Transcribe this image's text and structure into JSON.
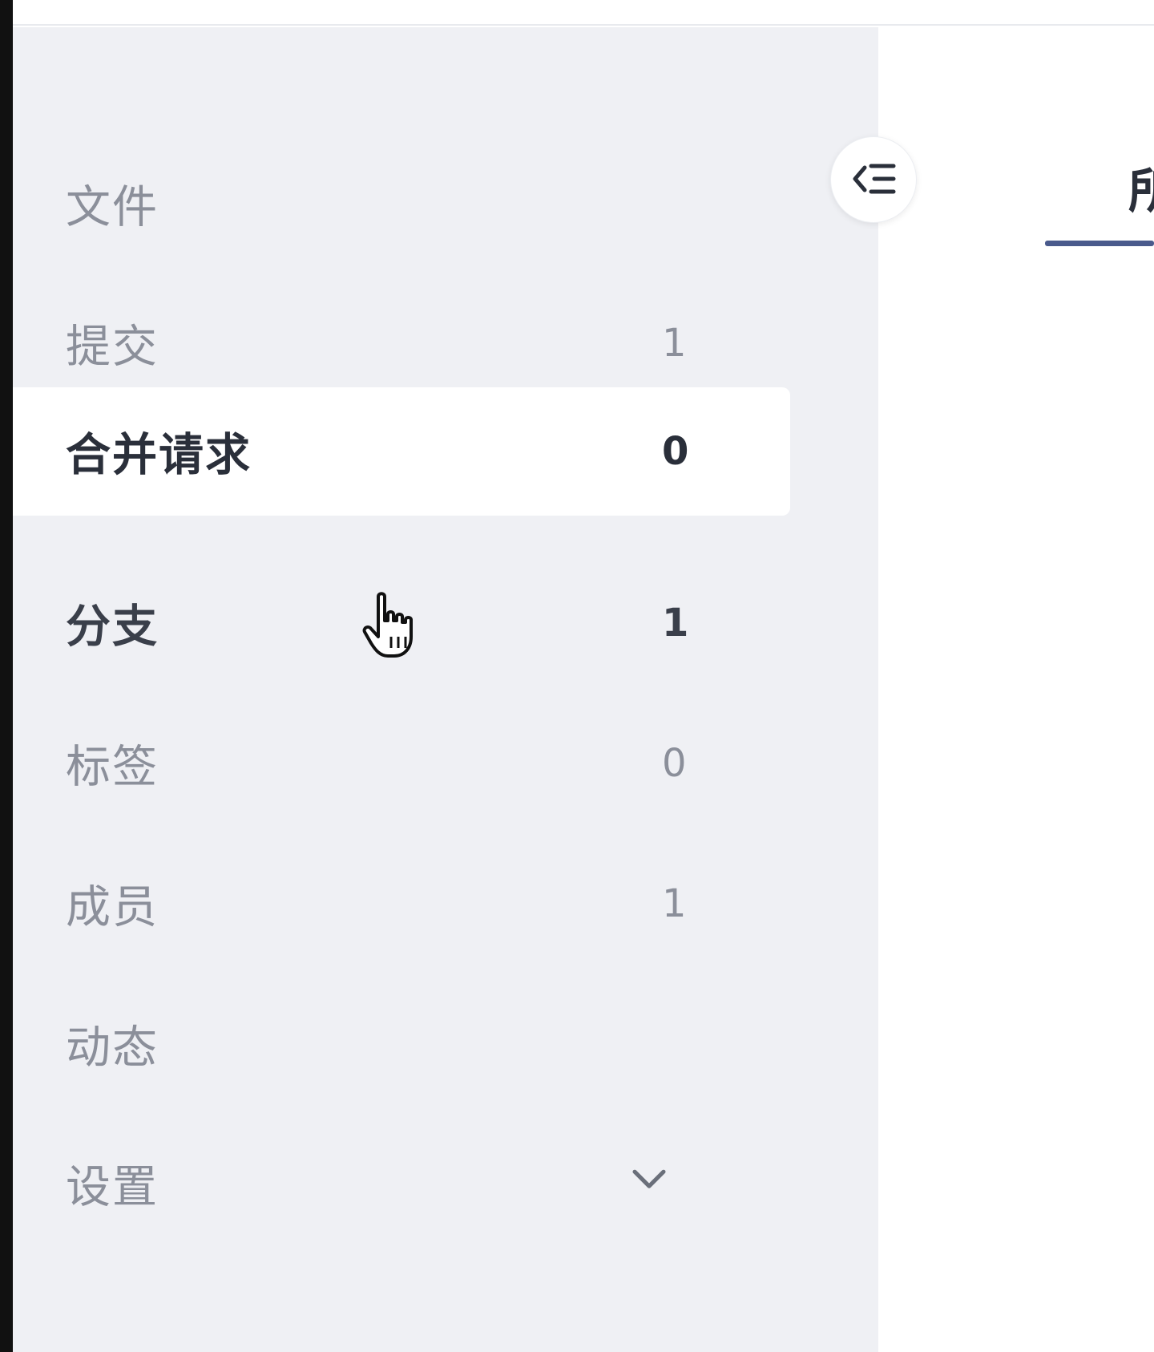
{
  "sidebar": {
    "items": [
      {
        "label": "文件",
        "count": ""
      },
      {
        "label": "提交",
        "count": "1"
      },
      {
        "label": "合并请求",
        "count": "0"
      },
      {
        "label": "分支",
        "count": "1"
      },
      {
        "label": "标签",
        "count": "0"
      },
      {
        "label": "成员",
        "count": "1"
      },
      {
        "label": "动态",
        "count": ""
      },
      {
        "label": "设置",
        "count": ""
      }
    ],
    "active_index": 2,
    "collapse_icon": "collapse-sidebar-icon"
  },
  "main": {
    "tab_label": "所"
  },
  "colors": {
    "sidebar_bg": "#eff0f4",
    "active_bg": "#ffffff",
    "accent": "#4a5a8c",
    "muted_text": "#8b8f9a",
    "strong_text": "#2a2f3a"
  }
}
